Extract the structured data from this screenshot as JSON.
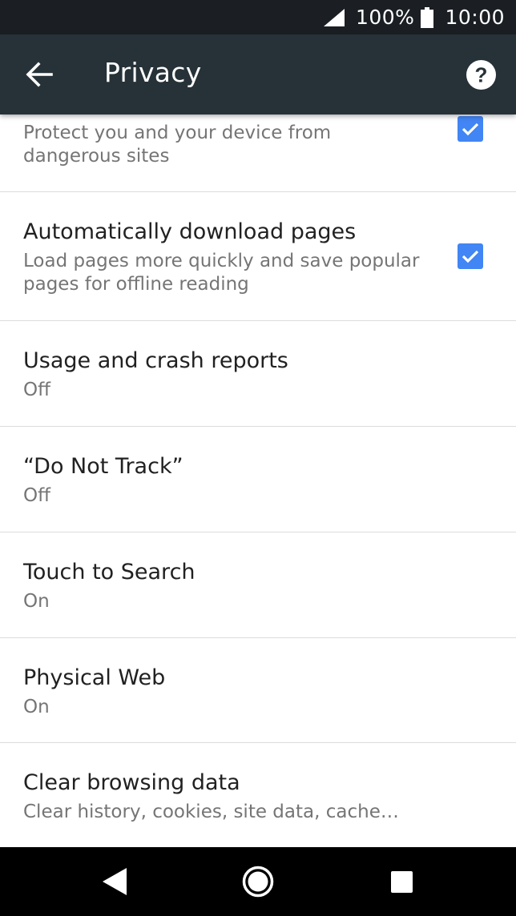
{
  "status_bar": {
    "battery_percent": "100%",
    "time": "10:00"
  },
  "toolbar": {
    "title": "Privacy"
  },
  "settings": [
    {
      "secondary": "Protect you and your device from dangerous sites",
      "checked": true
    },
    {
      "primary": "Automatically download pages",
      "secondary": "Load pages more quickly and save popular pages for offline reading",
      "checked": true
    },
    {
      "primary": "Usage and crash reports",
      "secondary": "Off"
    },
    {
      "primary": "“Do Not Track”",
      "secondary": "Off"
    },
    {
      "primary": "Touch to Search",
      "secondary": "On"
    },
    {
      "primary": "Physical Web",
      "secondary": "On"
    },
    {
      "primary": "Clear browsing data",
      "secondary": "Clear history, cookies, site data, cache…"
    }
  ],
  "colors": {
    "toolbar": "#263238",
    "status_bar": "#1b1f24",
    "checkbox": "#4285f4",
    "divider": "#dcdcdc"
  }
}
